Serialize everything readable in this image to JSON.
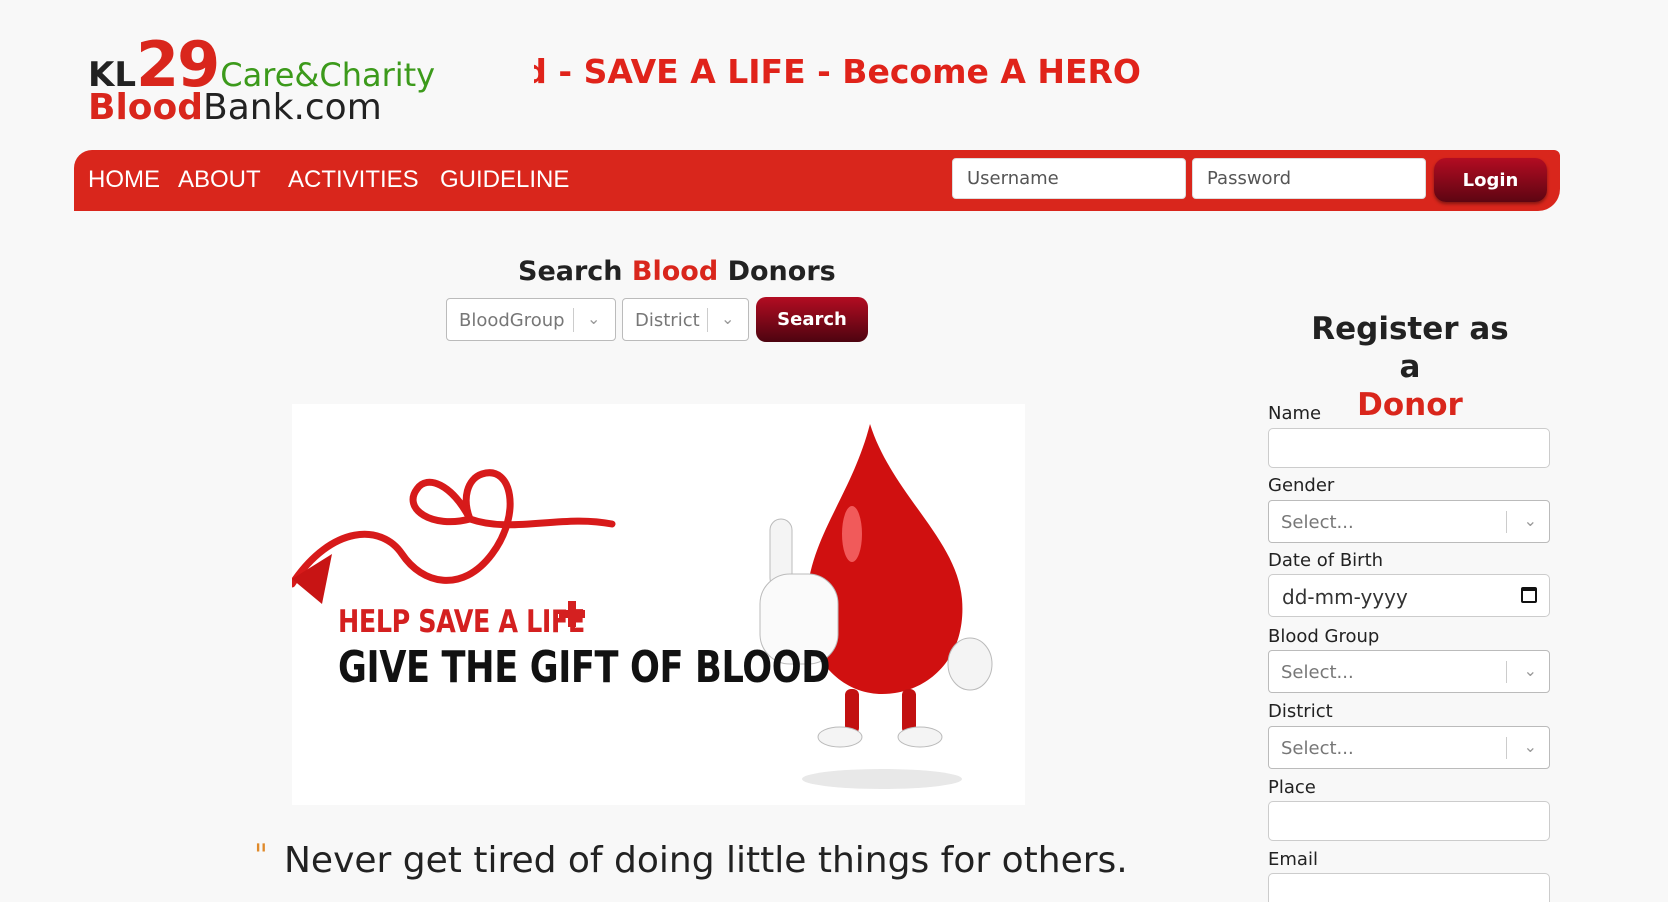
{
  "logo": {
    "prefix": "KL",
    "number": "29",
    "tagline": "Care&Charity",
    "blood": "Blood",
    "domain": "Bank.com"
  },
  "marquee": {
    "text": "Donate Blood - SAVE A LIFE - Become A HERO"
  },
  "nav": {
    "links": [
      "HOME",
      "ABOUT",
      "ACTIVITIES",
      "GUIDELINE"
    ],
    "username_placeholder": "Username",
    "password_placeholder": "Password",
    "login_label": "Login"
  },
  "search": {
    "title_pre": "Search ",
    "title_red": "Blood",
    "title_post": " Donors",
    "blood_group_placeholder": "BloodGroup",
    "district_placeholder": "District",
    "button_label": "Search"
  },
  "banner": {
    "line1": "HELP SAVE A LIFE",
    "line2": "GIVE THE GIFT OF BLOOD"
  },
  "quote": {
    "mark": "\"",
    "text": "Never get tired of doing little things for others."
  },
  "register": {
    "title_pre": "Register as a",
    "title_red": "Donor",
    "fields": {
      "name_label": "Name",
      "gender_label": "Gender",
      "gender_placeholder": "Select...",
      "dob_label": "Date of Birth",
      "dob_placeholder": "dd-mm-yyyy",
      "blood_group_label": "Blood Group",
      "blood_group_placeholder": "Select...",
      "district_label": "District",
      "district_placeholder": "Select...",
      "place_label": "Place",
      "email_label": "Email"
    }
  },
  "colors": {
    "brand_red": "#d9261c",
    "button_dark_red": "#8a0818",
    "logo_green": "#3c9a1b"
  }
}
